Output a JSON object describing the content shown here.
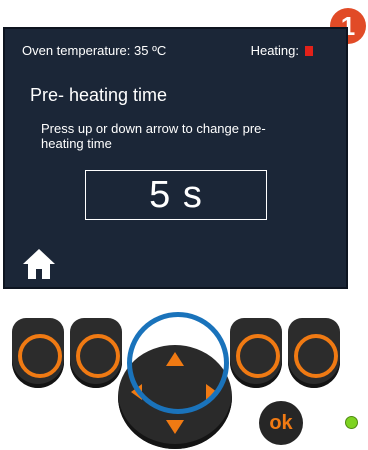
{
  "callout": {
    "number": "1"
  },
  "status": {
    "oven_temperature": "Oven temperature: 35 ºC",
    "heating_label": "Heating:"
  },
  "screen": {
    "title": "Pre- heating time",
    "hint": "Press up or down arrow to change pre- heating time",
    "value": "5 s"
  },
  "keypad": {
    "ok_label": "ok"
  },
  "icons": {
    "home": "home-icon",
    "heating": "heating-indicator-icon",
    "up": "up-arrow-icon",
    "down": "down-arrow-icon",
    "left": "left-arrow-icon",
    "right": "right-arrow-icon"
  },
  "colors": {
    "screen_bg": "#1b2637",
    "accent_orange": "#f07a13",
    "highlight_ring": "#1a73bb",
    "heating_red": "#e32119",
    "callout_red": "#e14b27",
    "led_green": "#7ed321"
  }
}
